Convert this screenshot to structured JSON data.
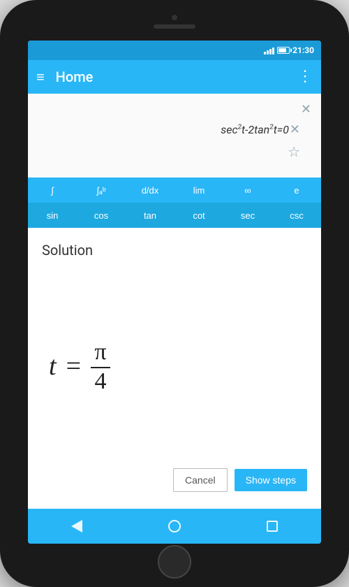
{
  "statusBar": {
    "time": "21:30"
  },
  "appBar": {
    "title": "Home"
  },
  "equationArea": {
    "equation": "sec²t-2tan²t=0"
  },
  "keyboard": {
    "topRow": [
      {
        "label": "∫",
        "key": "integral"
      },
      {
        "label": "∫ₐᵇ",
        "key": "definite-integral"
      },
      {
        "label": "d/dx",
        "key": "derivative"
      },
      {
        "label": "lim",
        "key": "limit"
      },
      {
        "label": "∞",
        "key": "infinity"
      },
      {
        "label": "e",
        "key": "euler"
      }
    ],
    "bottomRow": [
      {
        "label": "sin",
        "key": "sin"
      },
      {
        "label": "cos",
        "key": "cos"
      },
      {
        "label": "tan",
        "key": "tan"
      },
      {
        "label": "cot",
        "key": "cot"
      },
      {
        "label": "sec",
        "key": "sec"
      },
      {
        "label": "csc",
        "key": "csc"
      }
    ]
  },
  "solution": {
    "label": "Solution",
    "variable": "t",
    "equals": "=",
    "numerator": "π",
    "denominator": "4"
  },
  "buttons": {
    "cancel": "Cancel",
    "showSteps": "Show steps"
  },
  "navBar": {
    "back": "back",
    "home": "home",
    "recents": "recents"
  }
}
